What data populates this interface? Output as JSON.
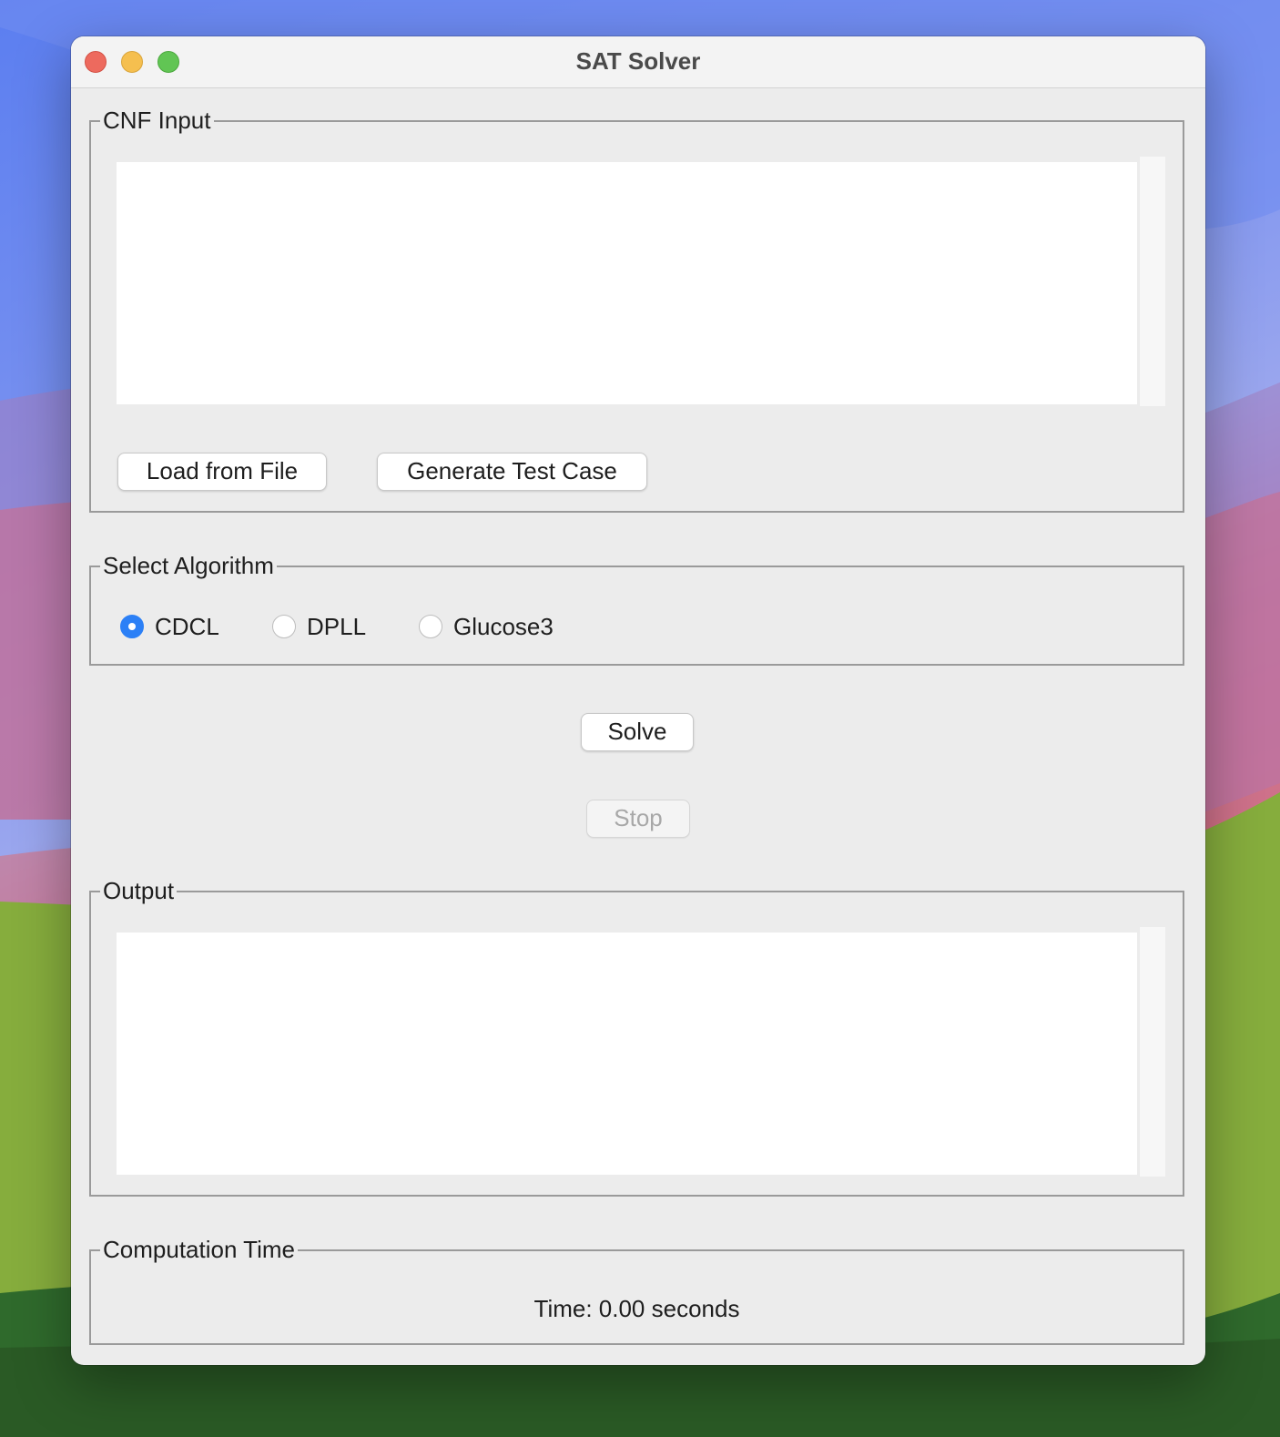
{
  "window": {
    "title": "SAT Solver"
  },
  "cnf_input": {
    "label": "CNF Input",
    "value": "",
    "load_button": "Load from File",
    "generate_button": "Generate Test Case"
  },
  "algorithm": {
    "label": "Select Algorithm",
    "options": [
      {
        "label": "CDCL",
        "selected": true
      },
      {
        "label": "DPLL",
        "selected": false
      },
      {
        "label": "Glucose3",
        "selected": false
      }
    ]
  },
  "actions": {
    "solve_button": "Solve",
    "stop_button": "Stop",
    "stop_enabled": false
  },
  "output": {
    "label": "Output",
    "value": ""
  },
  "computation_time": {
    "label": "Computation Time",
    "text": "Time: 0.00 seconds"
  },
  "colors": {
    "accent": "#2c80f6",
    "close": "#ed6a5e",
    "minimize": "#f5bf4f",
    "maximize": "#61c554"
  }
}
